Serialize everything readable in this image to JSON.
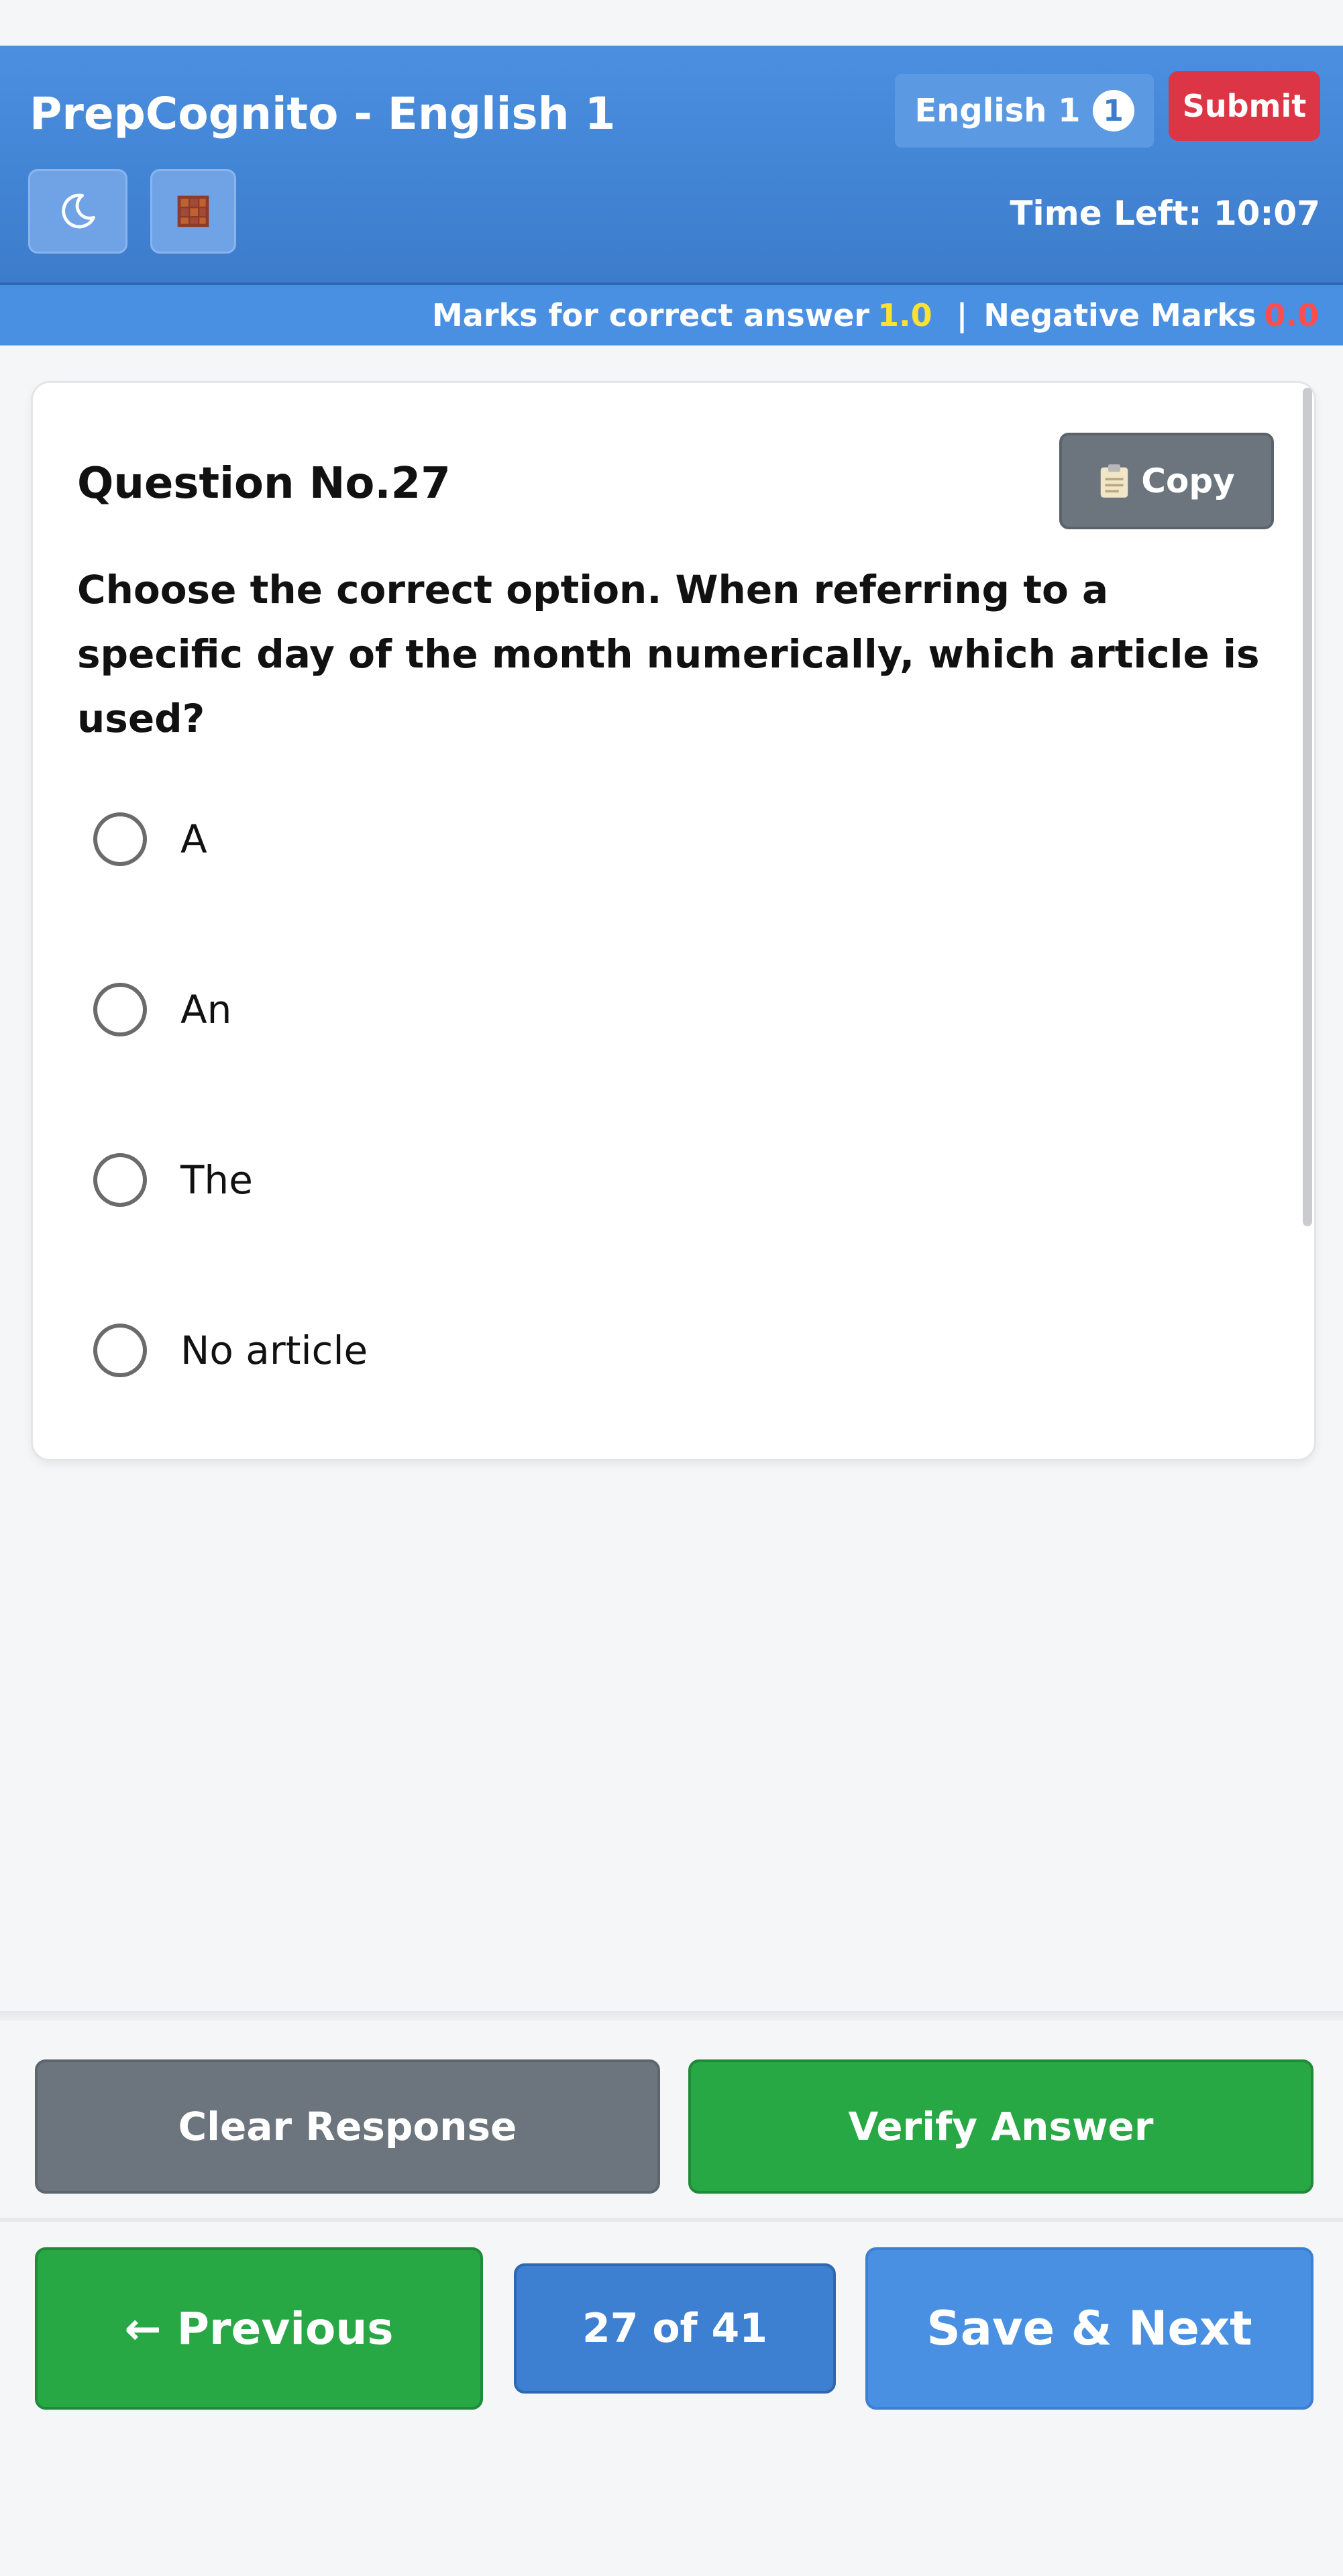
{
  "header": {
    "title": "PrepCognito - English 1",
    "subject_chip": "English 1",
    "subject_count": "1",
    "submit_label": "Submit",
    "time_left": "Time Left: 10:07",
    "icons": [
      "moon-icon",
      "grid-icon"
    ]
  },
  "marks": {
    "correct_label": "Marks for correct answer",
    "correct_value": "1.0",
    "separator": "|",
    "negative_label": "Negative Marks",
    "negative_value": "0.0"
  },
  "question": {
    "number": "Question No.27",
    "copy_label": "Copy",
    "text": "Choose the correct option. When referring to a specific day of the month numerically, which article is used?",
    "options": [
      "A",
      "An",
      "The",
      "No article"
    ]
  },
  "actions": {
    "clear_label": "Clear Response",
    "verify_label": "Verify Answer"
  },
  "navigation": {
    "previous_label": "← Previous",
    "counter": "27 of 41",
    "next_label": "Save & Next"
  },
  "colors": {
    "header_blue": "#4a90e2",
    "submit_red": "#dc3545",
    "success_green": "#28a745",
    "secondary_gray": "#6c757d",
    "highlight_yellow": "#ffe033",
    "negative_red": "#ff4d4d"
  }
}
